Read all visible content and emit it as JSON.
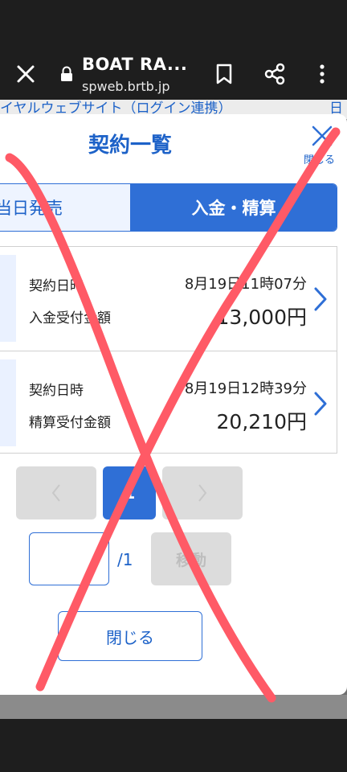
{
  "browser": {
    "title": "BOAT RA...",
    "url": "spweb.brtb.jp",
    "close_icon": "close-icon",
    "lock_icon": "lock-icon",
    "bookmark_icon": "bookmark-icon",
    "share_icon": "share-icon",
    "more_icon": "more-vert-icon"
  },
  "background_page": {
    "partial_text": "イヤルウェブサイト（ログイン連携）",
    "edge_text": "日"
  },
  "modal": {
    "title": "契約一覧",
    "close_label": "閉じる",
    "tabs": [
      {
        "label": "当日発売",
        "selected": false
      },
      {
        "label": "入金・精算",
        "selected": true
      }
    ],
    "contracts": [
      {
        "date_label": "契約日時",
        "date_value": "8月19日11時07分",
        "amount_label": "入金受付金額",
        "amount_value": "13,000円"
      },
      {
        "date_label": "契約日時",
        "date_value": "8月19日12時39分",
        "amount_label": "精算受付金額",
        "amount_value": "20,210円"
      }
    ],
    "pager": {
      "prev_icon": "chevron-left-icon",
      "current_page": "1",
      "next_icon": "chevron-right-icon"
    },
    "jump": {
      "input_value": "",
      "total_label": "/1",
      "button_label": "移動"
    },
    "close_button_label": "閉じる"
  },
  "colors": {
    "accent": "#2f6fd6",
    "overlay_x": "#ff5a66",
    "dark_chrome": "#1e1e1e"
  }
}
